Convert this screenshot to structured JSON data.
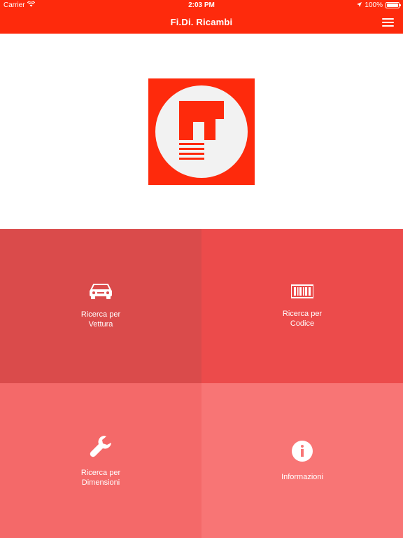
{
  "status_bar": {
    "carrier": "Carrier",
    "time": "2:03 PM",
    "battery": "100%",
    "icons": [
      "wifi-icon",
      "location-arrow-icon",
      "battery-icon"
    ]
  },
  "nav": {
    "title": "Fi.Di. Ricambi",
    "menu_icon": "hamburger-menu-icon"
  },
  "colors": {
    "brand": "#fe2a0c",
    "tile_vettura": "#da4b4b",
    "tile_codice": "#ec4b4b",
    "tile_dimensioni": "#f46969",
    "tile_informazioni": "#f87575"
  },
  "tiles": [
    {
      "icon": "car-icon",
      "label_line1": "Ricerca per",
      "label_line2": "Vettura"
    },
    {
      "icon": "barcode-icon",
      "label_line1": "Ricerca per",
      "label_line2": "Codice"
    },
    {
      "icon": "wrench-icon",
      "label_line1": "Ricerca per",
      "label_line2": "Dimensioni"
    },
    {
      "icon": "info-icon",
      "label_line1": "Informazioni",
      "label_line2": ""
    }
  ]
}
